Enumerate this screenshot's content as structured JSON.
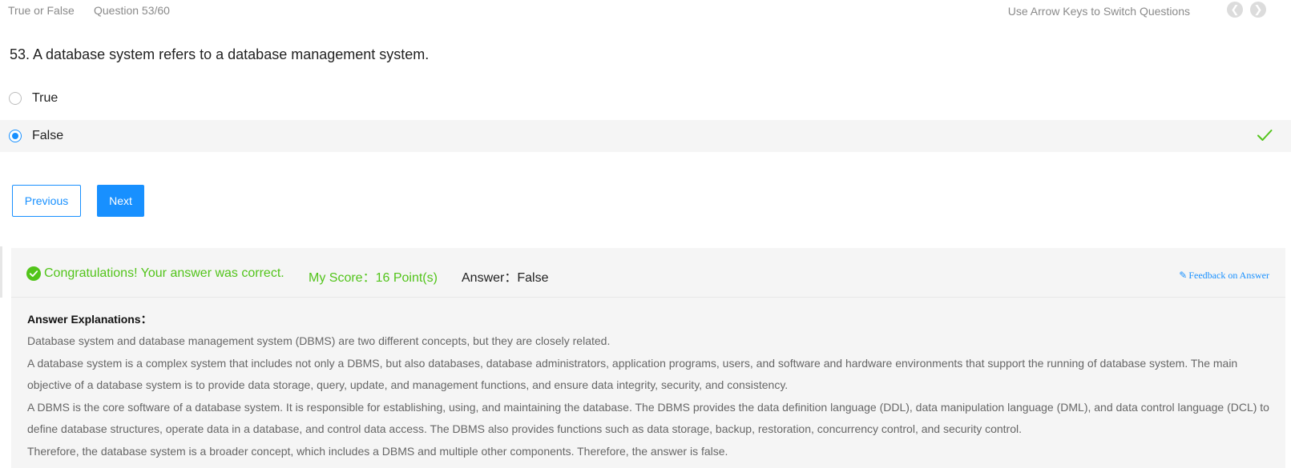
{
  "header": {
    "question_type": "True or False",
    "question_counter": "Question 53/60",
    "hint": "Use Arrow Keys to Switch Questions",
    "prev_icon": "chevron-left-icon",
    "next_icon": "chevron-right-icon"
  },
  "question": {
    "text": "53. A database system refers to a database management system."
  },
  "options": [
    {
      "label": "True",
      "selected": false
    },
    {
      "label": "False",
      "selected": true,
      "correct": true
    }
  ],
  "buttons": {
    "previous": "Previous",
    "next": "Next"
  },
  "result": {
    "message": "Congratulations! Your answer was correct.",
    "score": "My Score：16 Point(s)",
    "answer": "Answer：False",
    "feedback_link": "Feedback on Answer"
  },
  "explanation": {
    "heading": "Answer Explanations：",
    "paragraphs": [
      "Database system and database management system (DBMS) are two different concepts, but they are closely related.",
      "A database system is a complex system that includes not only a DBMS, but also databases, database administrators, application programs, users, and software and hardware environments that support the running of database system. The main objective of a database system is to provide data storage, query, update, and management functions, and ensure data integrity, security, and consistency.",
      "A DBMS is the core software of a database system. It is responsible for establishing, using, and maintaining the database. The DBMS provides the data definition language (DDL), data manipulation language (DML), and data control language (DCL) to define database structures, operate data in a database, and control data access. The DBMS also provides functions such as data storage, backup, restoration, concurrency control, and security control.",
      "Therefore, the database system is a broader concept, which includes a DBMS and multiple other components. Therefore, the answer is false."
    ]
  },
  "colors": {
    "accent": "#1890ff",
    "success": "#52c41a",
    "muted_text": "#8a8a8a",
    "panel_bg": "#f5f5f5"
  }
}
